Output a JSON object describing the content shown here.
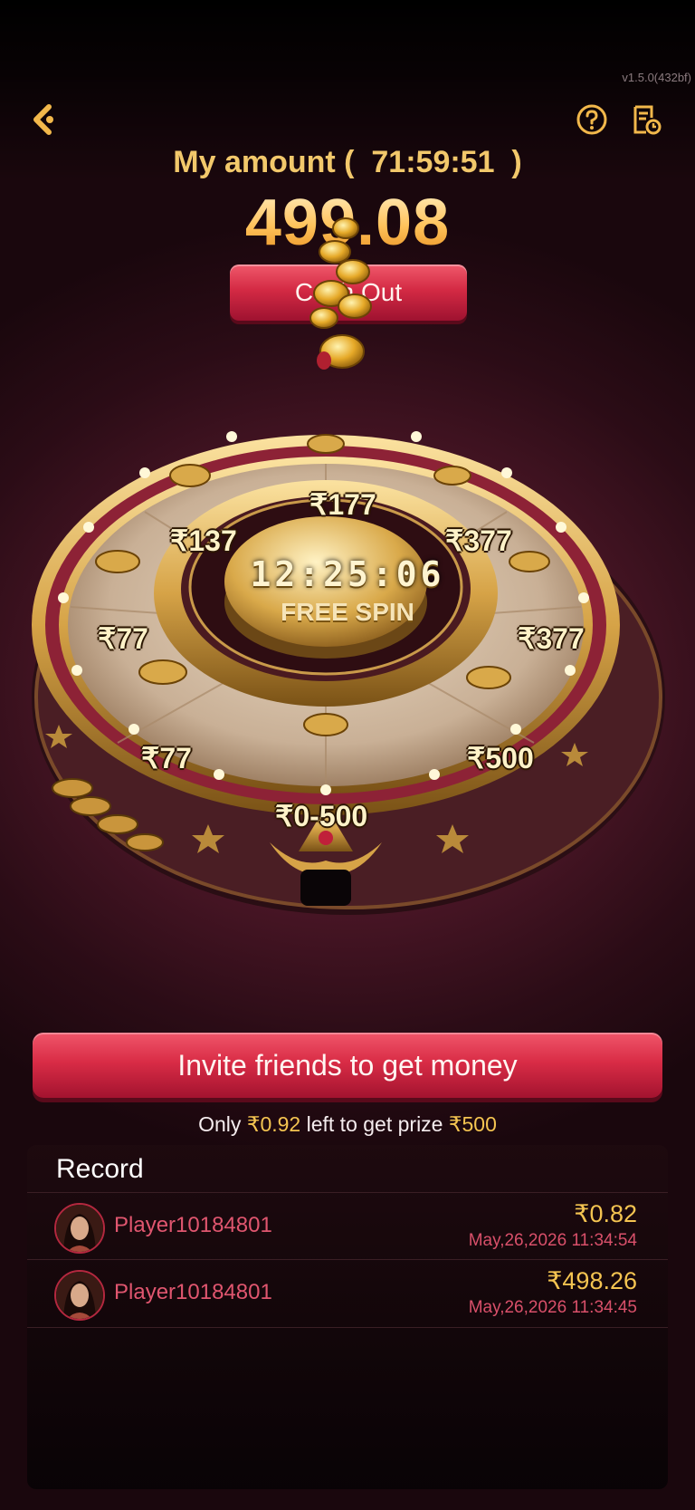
{
  "version": "v1.5.0(432bf)",
  "header": {
    "back_icon": "back-arrow-icon",
    "help_icon": "question-circle-icon",
    "history_icon": "record-history-icon",
    "amount_label": "My amount (  71:59:51  )",
    "amount_value": "499.08",
    "cashout_label": "Cash Out"
  },
  "wheel": {
    "timer": "12:25:06",
    "center_label": "FREE SPIN",
    "prizes": {
      "top": "₹177",
      "top_left": "₹137",
      "top_right": "₹377",
      "left": "₹77",
      "right": "₹377",
      "bottom_left": "₹77",
      "bottom_right": "₹500",
      "bottom": "₹0-500"
    }
  },
  "invite": {
    "button_label": "Invite friends to get money",
    "hint_prefix": "Only ",
    "hint_remaining": "₹0.92",
    "hint_middle": " left to get prize ",
    "hint_prize": "₹500"
  },
  "record": {
    "title": "Record",
    "rows": [
      {
        "player": "Player10184801",
        "amount": "₹0.82",
        "time": "May,26,2026 11:34:54"
      },
      {
        "player": "Player10184801",
        "amount": "₹498.26",
        "time": "May,26,2026 11:34:45"
      }
    ]
  },
  "colors": {
    "accent_gold": "#f4c451",
    "button_red": "#d92c46",
    "player_red": "#e0566f",
    "background": "#4a1626"
  }
}
